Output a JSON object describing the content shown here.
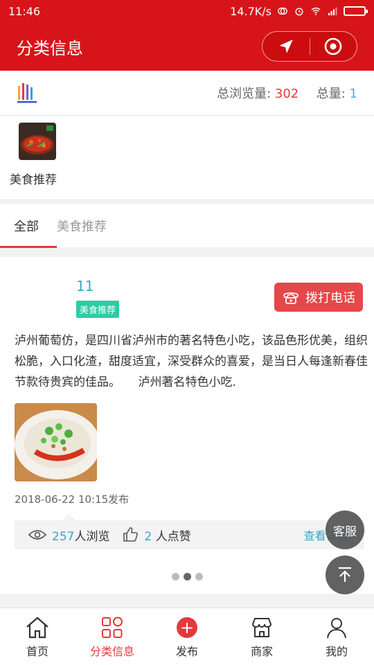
{
  "status_bar": {
    "time": "11:46",
    "network_speed": "14.7K/s"
  },
  "navbar": {
    "title": "分类信息"
  },
  "stats": {
    "views_label": "总浏览量:",
    "views_value": "302",
    "total_label": "总量:",
    "total_value": "1"
  },
  "categories": [
    {
      "label": "美食推荐"
    }
  ],
  "tabs": [
    {
      "label": "全部",
      "active": true
    },
    {
      "label": "美食推荐",
      "active": false
    }
  ],
  "post": {
    "name": "11",
    "badge": "美食推荐",
    "call_label": "拨打电话",
    "text": "泸州葡萄仿，是四川省泸州市的著名特色小吃，该品色形优美，组织松脆，入口化渣，甜度适宜，深受群众的喜爱，是当日人每逢新春佳节款待贵宾的佳品。　　泸州著名特色小吃.",
    "time": "2018-06-22 10:15发布",
    "views_count": "257",
    "views_suffix": "人浏览",
    "likes_count": "2",
    "likes_suffix": "人点赞",
    "more_label": "查看详情>"
  },
  "floating": {
    "service_label": "客服"
  },
  "tabbar": [
    {
      "label": "首页",
      "icon": "home-icon",
      "active": false
    },
    {
      "label": "分类信息",
      "icon": "category-icon",
      "active": true
    },
    {
      "label": "发布",
      "icon": "publish-icon",
      "active": false
    },
    {
      "label": "商家",
      "icon": "store-icon",
      "active": false
    },
    {
      "label": "我的",
      "icon": "user-icon",
      "active": false
    }
  ],
  "colors": {
    "brand_red": "#d7141a",
    "accent_blue": "#38a6c9",
    "badge_green": "#2dcba6"
  }
}
